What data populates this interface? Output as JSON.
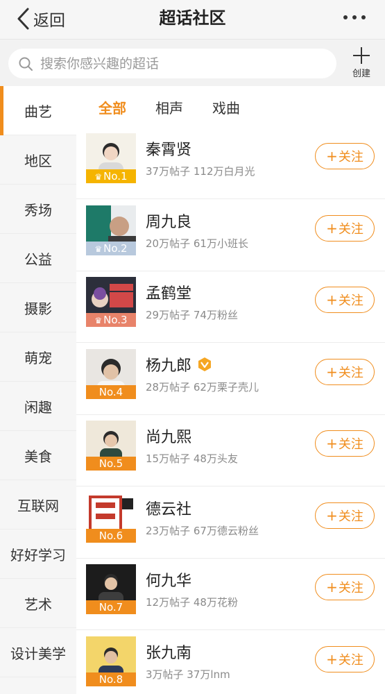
{
  "nav": {
    "back_label": "返回",
    "title": "超话社区"
  },
  "search": {
    "placeholder": "搜索你感兴趣的超话",
    "create_label": "创建"
  },
  "sidebar": {
    "items": [
      {
        "label": "曲艺"
      },
      {
        "label": "地区"
      },
      {
        "label": "秀场"
      },
      {
        "label": "公益"
      },
      {
        "label": "摄影"
      },
      {
        "label": "萌宠"
      },
      {
        "label": "闲趣"
      },
      {
        "label": "美食"
      },
      {
        "label": "互联网"
      },
      {
        "label": "好好学习"
      },
      {
        "label": "艺术"
      },
      {
        "label": "设计美学"
      }
    ],
    "active_index": 0
  },
  "tabs": [
    {
      "label": "全部"
    },
    {
      "label": "相声"
    },
    {
      "label": "戏曲"
    }
  ],
  "follow_label": "关注",
  "accent_color": "#f08d1d",
  "list": [
    {
      "name": "秦霄贤",
      "stats": "37万帖子 112万白月光",
      "rank": "No.1",
      "rank_color": "#f5b400",
      "crown": true,
      "verified": false
    },
    {
      "name": "周九良",
      "stats": "20万帖子 61万小班长",
      "rank": "No.2",
      "rank_color": "#b8c9dd",
      "crown": true,
      "verified": false
    },
    {
      "name": "孟鹤堂",
      "stats": "29万帖子 74万粉丝",
      "rank": "No.3",
      "rank_color": "#e8836a",
      "crown": true,
      "verified": false
    },
    {
      "name": "杨九郎",
      "stats": "28万帖子 62万栗子壳儿",
      "rank": "No.4",
      "rank_color": "#f08d1d",
      "crown": false,
      "verified": true
    },
    {
      "name": "尚九熙",
      "stats": "15万帖子 48万头友",
      "rank": "No.5",
      "rank_color": "#f08d1d",
      "crown": false,
      "verified": false
    },
    {
      "name": "德云社",
      "stats": "23万帖子 67万德云粉丝",
      "rank": "No.6",
      "rank_color": "#f08d1d",
      "crown": false,
      "verified": false
    },
    {
      "name": "何九华",
      "stats": "12万帖子 48万花粉",
      "rank": "No.7",
      "rank_color": "#f08d1d",
      "crown": false,
      "verified": false
    },
    {
      "name": "张九南",
      "stats": "3万帖子 37万lnm",
      "rank": "No.8",
      "rank_color": "#f08d1d",
      "crown": false,
      "verified": false
    }
  ]
}
